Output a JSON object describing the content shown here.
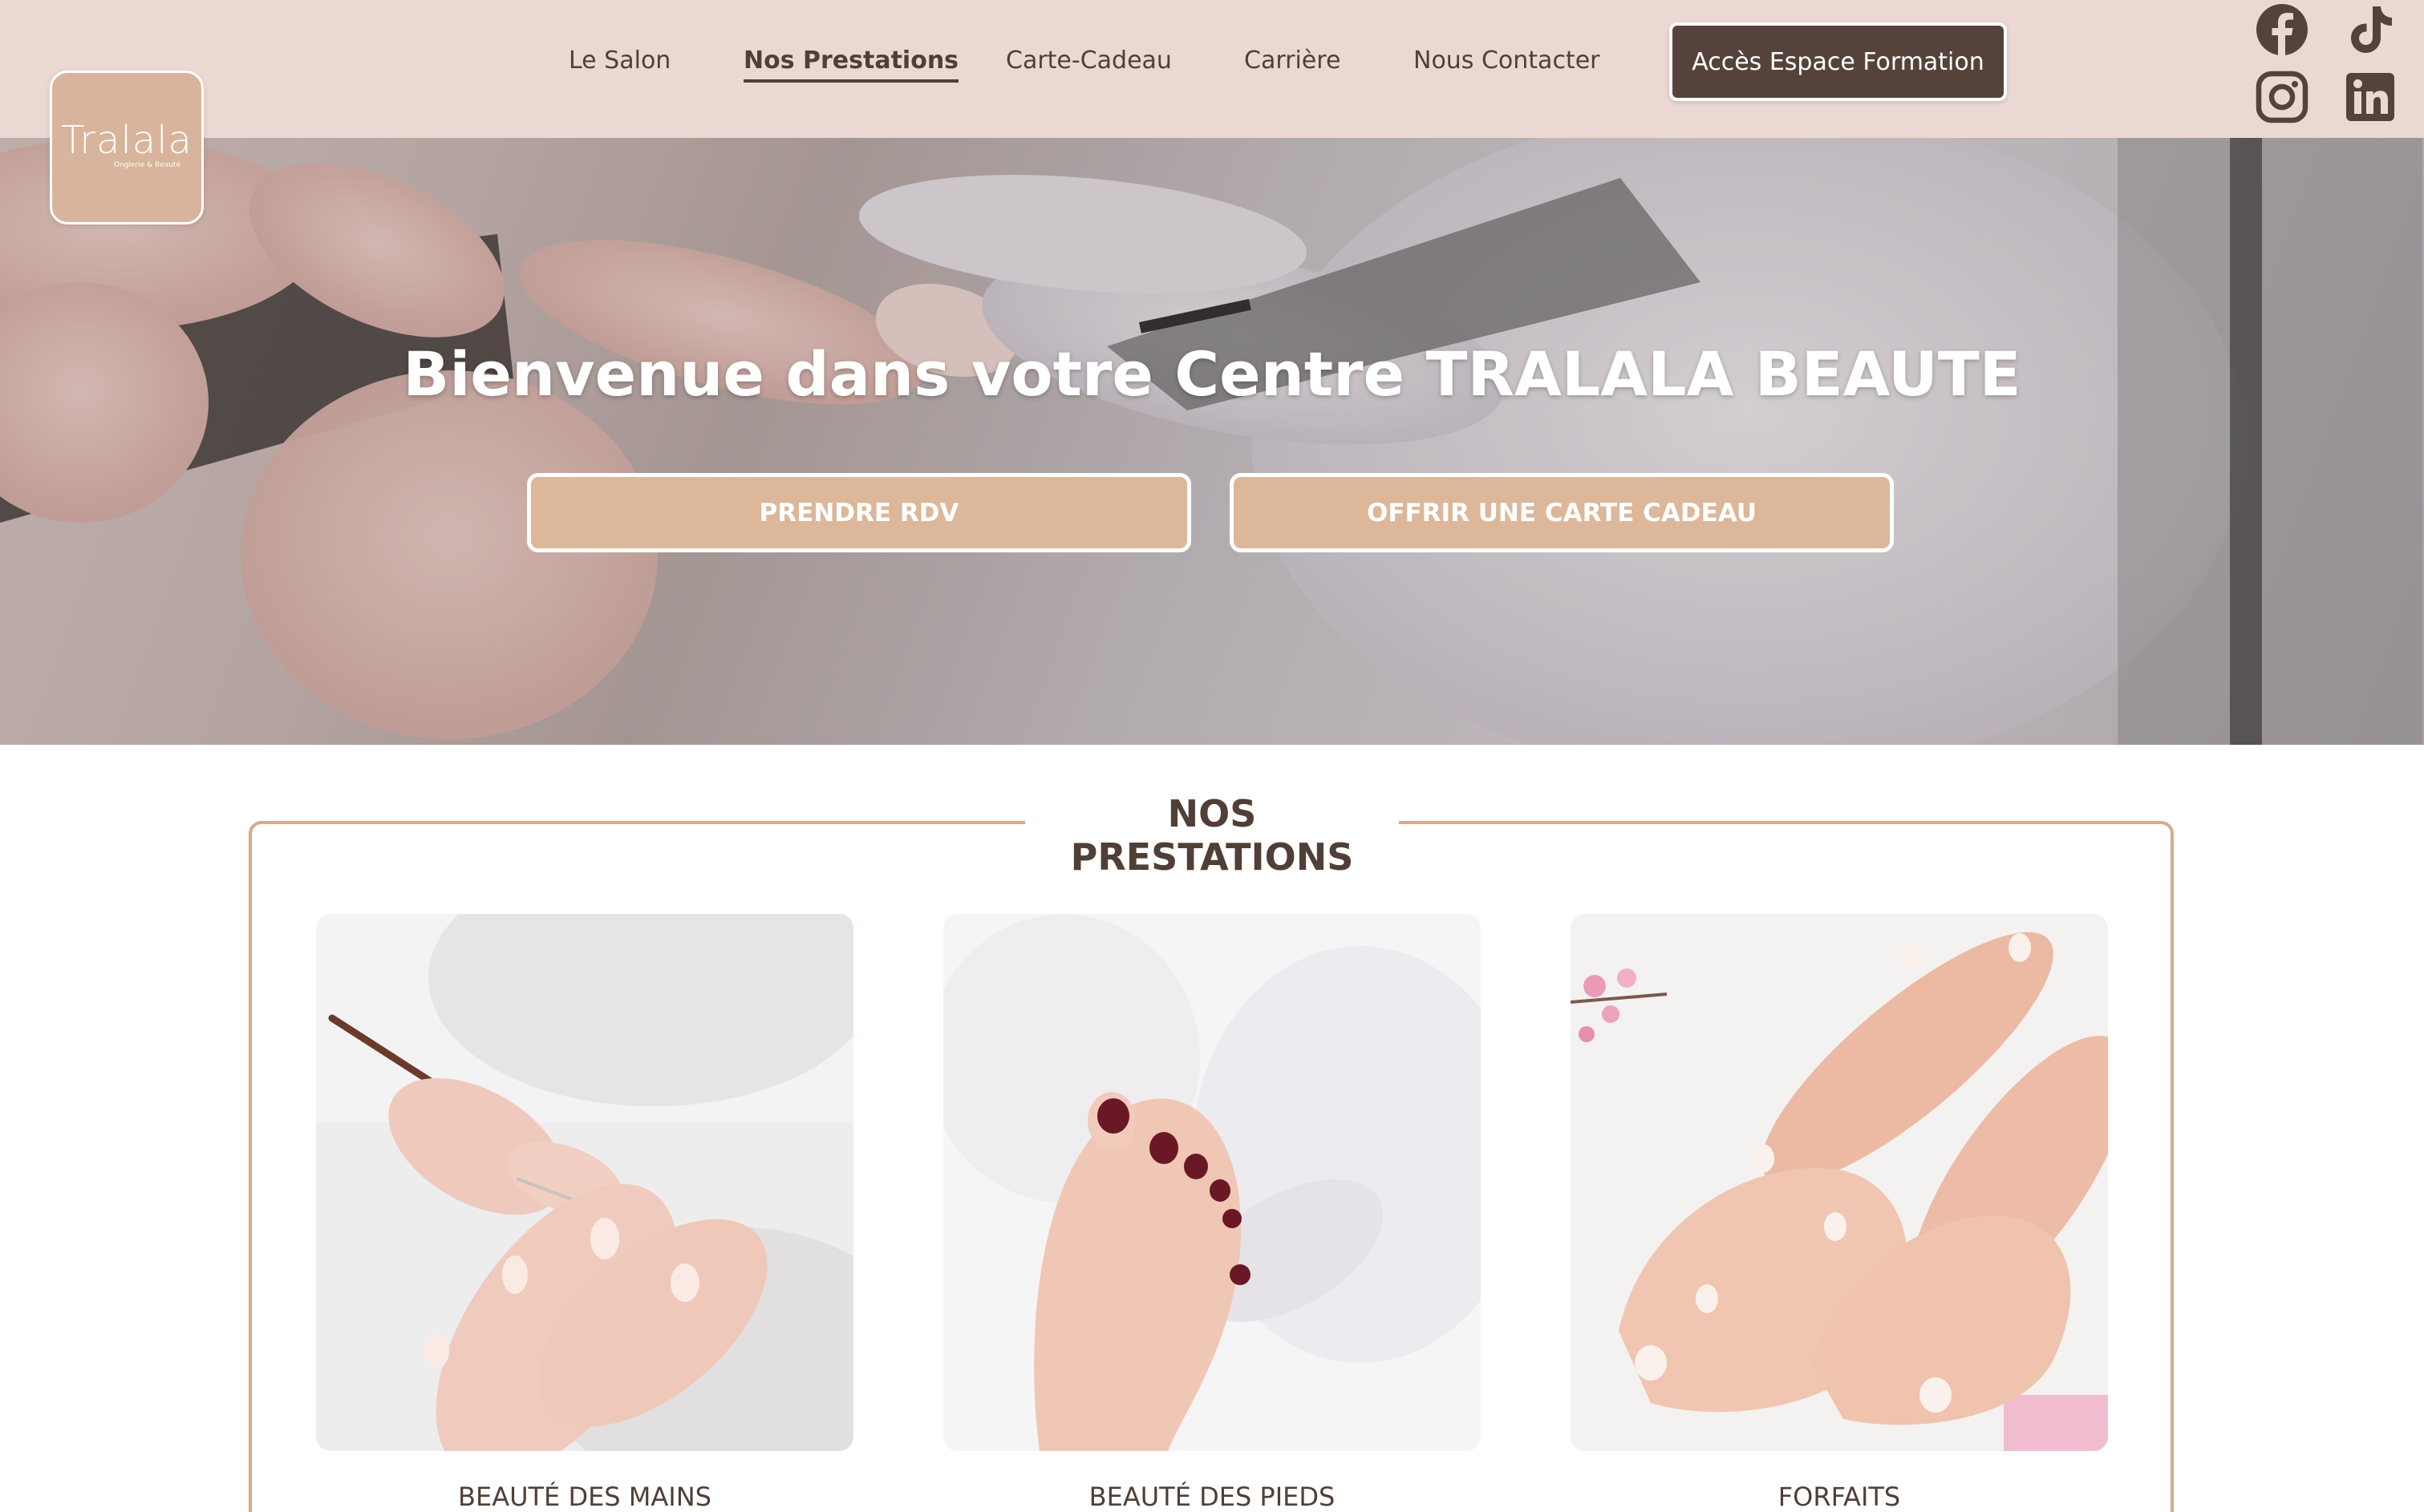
{
  "brand": {
    "logo_text": "Tralala",
    "logo_tagline": "Onglerie & Beauté",
    "logo_bg": "#d7b49b"
  },
  "nav": {
    "items": [
      {
        "label": "Le Salon",
        "active": false
      },
      {
        "label": "Nos Prestations",
        "active": true
      },
      {
        "label": "Carte-Cadeau",
        "active": false
      },
      {
        "label": "Carrière",
        "active": false
      },
      {
        "label": "Nous Contacter",
        "active": false
      }
    ],
    "cta_label": "Accès Espace Formation"
  },
  "social": {
    "icons": [
      "facebook-icon",
      "tiktok-icon",
      "instagram-icon",
      "linkedin-icon"
    ]
  },
  "hero": {
    "title": "Bienvenue dans votre Centre TRALALA BEAUTE",
    "primary_button": "PRENDRE RDV",
    "secondary_button": "OFFRIR UNE CARTE CADEAU"
  },
  "prestations": {
    "title": "NOS PRESTATIONS",
    "cards": [
      {
        "label": "BEAUTÉ DES MAINS",
        "image": "manicure-photo"
      },
      {
        "label": "BEAUTÉ DES PIEDS",
        "image": "pedicure-photo"
      },
      {
        "label": "FORFAITS",
        "image": "hands-and-feet-photo"
      }
    ]
  },
  "colors": {
    "header_bg": "#ecd8d3",
    "text_dark": "#4f3f36",
    "cta_dark": "#55433b",
    "accent_tan": "#dcb79a",
    "border_tan": "#d8a98b"
  }
}
